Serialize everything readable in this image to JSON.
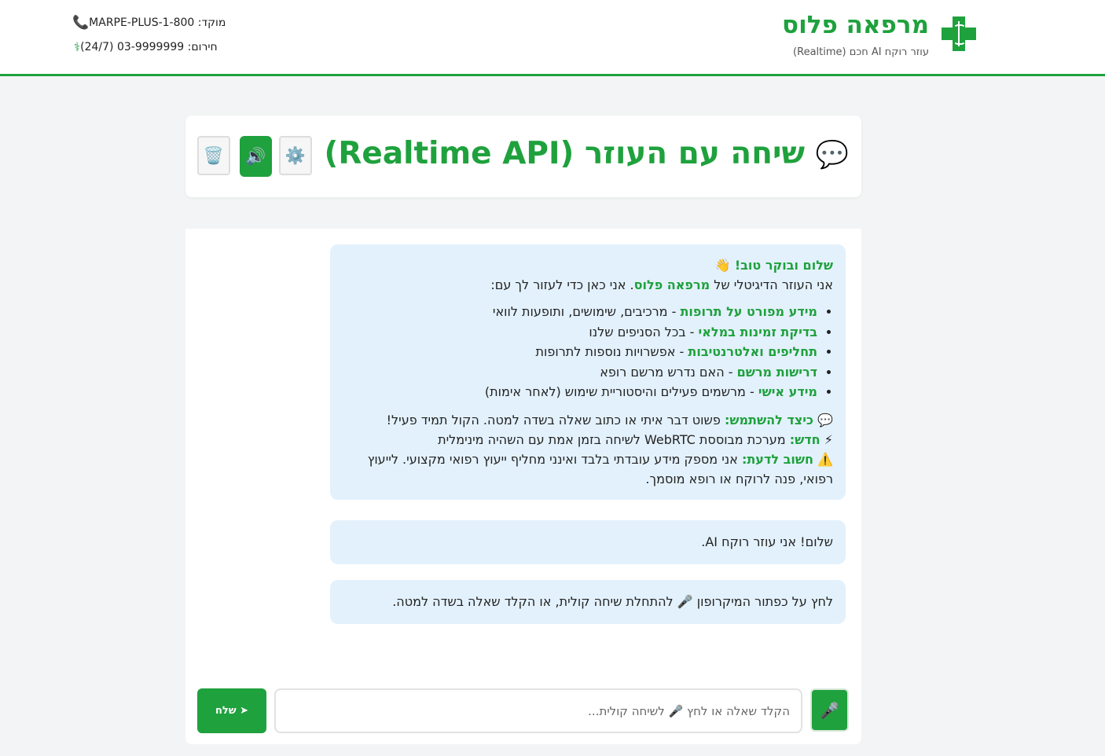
{
  "header": {
    "brand_title": "מרפאה פלוס",
    "brand_subtitle": "עוזר רוקח AI חכם (Realtime)",
    "hotline_label": "מוקד: MARPE-PLUS-1-800",
    "emergency_label": "חירום: 03-9999999 (24/7)",
    "phone_icon": "📞",
    "caduceus_icon": "⚕"
  },
  "chat_header": {
    "speech_icon": "💬",
    "title": "שיחה עם העוזר (Realtime API)",
    "settings_icon": "⚙️",
    "sound_icon": "🔊",
    "trash_icon": "🗑️"
  },
  "welcome": {
    "greeting": "שלום ובוקר טוב!",
    "wave_icon": "👋",
    "intro_prefix": "אני העוזר הדיגיטלי של ",
    "intro_brand": "מרפאה פלוס",
    "intro_suffix": ". אני כאן כדי לעזור לך עם:",
    "items": [
      {
        "title": "מידע מפורט על תרופות",
        "desc": " - מרכיבים, שימושים, ותופעות לוואי"
      },
      {
        "title": "בדיקת זמינות במלאי",
        "desc": " - בכל הסניפים שלנו"
      },
      {
        "title": "תחליפים ואלטרנטיבות",
        "desc": " - אפשרויות נוספות לתרופות"
      },
      {
        "title": "דרישות מרשם",
        "desc": " - האם נדרש מרשם רופא"
      },
      {
        "title": "מידע אישי",
        "desc": " - מרשמים פעילים והיסטוריית שימוש (לאחר אימות)"
      }
    ],
    "howto_icon": "💬",
    "howto_title": "כיצד להשתמש:",
    "howto_text": " פשוט דבר איתי או כתוב שאלה בשדה למטה. הקול תמיד פעיל!",
    "new_icon": "⚡",
    "new_title": "חדש:",
    "new_text": " מערכת מבוססת WebRTC לשיחה בזמן אמת עם השהיה מינימלית",
    "warn_icon": "⚠️",
    "warn_title": "חשוב לדעת:",
    "warn_text": " אני מספק מידע עובדתי בלבד ואינני מחליף ייעוץ רפואי מקצועי. לייעוץ רפואי, פנה לרוקח או רופא מוסמך."
  },
  "messages": [
    {
      "text": "שלום! אני עוזר רוקח AI."
    },
    {
      "text": "לחץ על כפתור המיקרופון 🎤 להתחלת שיחה קולית, או הקלד שאלה בשדה למטה."
    }
  ],
  "input": {
    "send_label": "➤ שלח",
    "placeholder": "הקלד שאלה או לחץ 🎤 לשיחה קולית...",
    "value": "",
    "mic_icon": "🎤"
  },
  "colors": {
    "brand_green": "#1fa13d",
    "bubble_bg": "#e3f1fc"
  }
}
